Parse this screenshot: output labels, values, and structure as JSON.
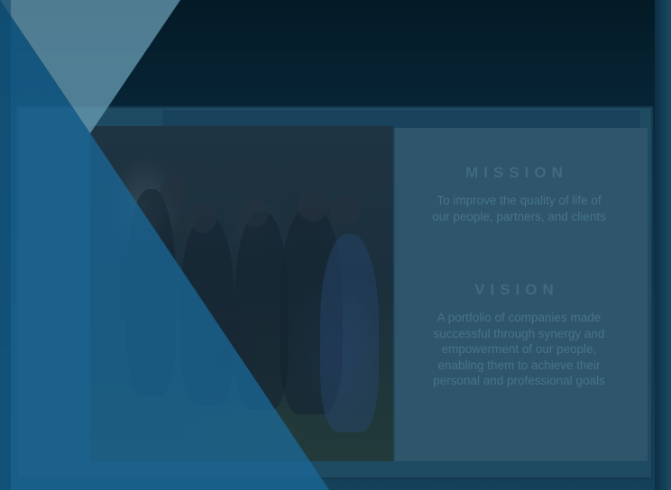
{
  "mission": {
    "heading": "MISSION",
    "text": "To improve the quality of life of our people, partners, and clients"
  },
  "vision": {
    "heading": "VISION",
    "text": "A portfolio of companies made successful through synergy and empowerment of our people, enabling them to achieve their personal and professional goals"
  },
  "colors": {
    "overlay_light_blue": "#5b8fa8",
    "overlay_dark_blue": "#1a6b9c",
    "panel": "#2e5569",
    "heading_text": "#3f6a80"
  },
  "photo": {
    "icon": "team-group-photo"
  }
}
